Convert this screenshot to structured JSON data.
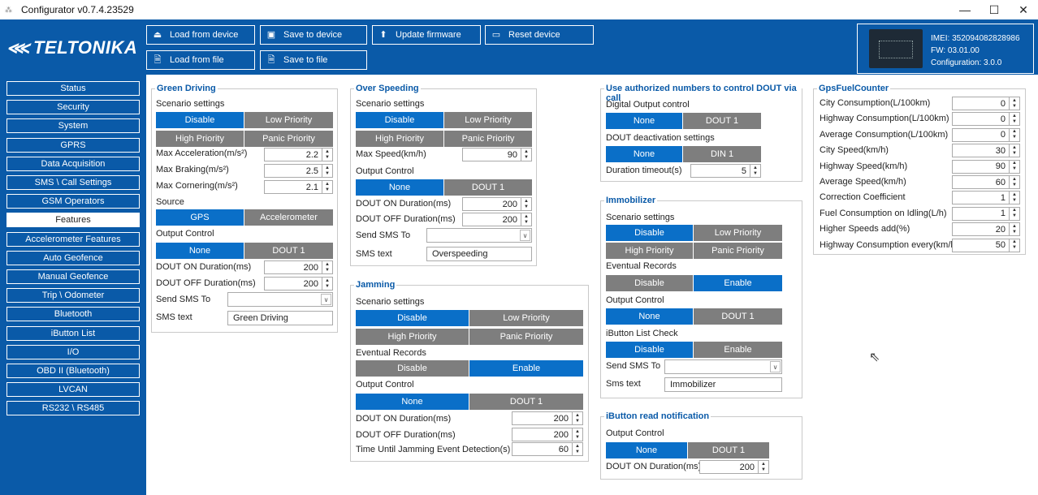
{
  "window": {
    "title": "Configurator v0.7.4.23529",
    "minimize": "—",
    "maximize": "☐",
    "close": "✕"
  },
  "brand": {
    "logo_text": "TELTONIKA"
  },
  "toolbar": {
    "load_device": "Load from device",
    "save_device": "Save to device",
    "update_firmware": "Update firmware",
    "reset_device": "Reset device",
    "load_file": "Load from file",
    "save_file": "Save to file"
  },
  "device": {
    "imei": "IMEI: 352094082828986",
    "fw": "FW: 03.01.00",
    "config": "Configuration: 3.0.0"
  },
  "nav": [
    "Status",
    "Security",
    "System",
    "GPRS",
    "Data Acquisition",
    "SMS \\ Call Settings",
    "GSM Operators",
    "Features",
    "Accelerometer Features",
    "Auto Geofence",
    "Manual Geofence",
    "Trip \\ Odometer",
    "Bluetooth",
    "iButton List",
    "I/O",
    "OBD II (Bluetooth)",
    "LVCAN",
    "RS232 \\ RS485"
  ],
  "nav_active": "Features",
  "green": {
    "title": "Green Driving",
    "scenario_label": "Scenario settings",
    "disable": "Disable",
    "low": "Low Priority",
    "high": "High Priority",
    "panic": "Panic Priority",
    "max_acc_label": "Max Acceleration(m/s²)",
    "max_acc": "2.2",
    "max_brk_label": "Max Braking(m/s²)",
    "max_brk": "2.5",
    "max_cor_label": "Max Cornering(m/s²)",
    "max_cor": "2.1",
    "source_label": "Source",
    "gps": "GPS",
    "accel": "Accelerometer",
    "output_label": "Output Control",
    "none": "None",
    "dout1": "DOUT 1",
    "on_label": "DOUT ON Duration(ms)",
    "on": "200",
    "off_label": "DOUT OFF Duration(ms)",
    "off": "200",
    "sms_to_label": "Send SMS To",
    "sms_text_label": "SMS text",
    "sms_text": "Green Driving"
  },
  "overspeed": {
    "title": "Over Speeding",
    "scenario_label": "Scenario settings",
    "disable": "Disable",
    "low": "Low Priority",
    "high": "High Priority",
    "panic": "Panic Priority",
    "max_speed_label": "Max Speed(km/h)",
    "max_speed": "90",
    "output_label": "Output Control",
    "none": "None",
    "dout1": "DOUT 1",
    "on_label": "DOUT ON Duration(ms)",
    "on": "200",
    "off_label": "DOUT OFF Duration(ms)",
    "off": "200",
    "sms_to_label": "Send SMS To",
    "sms_text_label": "SMS text",
    "sms_text": "Overspeeding"
  },
  "jamming": {
    "title": "Jamming",
    "scenario_label": "Scenario settings",
    "disable": "Disable",
    "low": "Low Priority",
    "high": "High Priority",
    "panic": "Panic Priority",
    "records_label": "Eventual Records",
    "rec_disable": "Disable",
    "rec_enable": "Enable",
    "output_label": "Output Control",
    "none": "None",
    "dout1": "DOUT 1",
    "on_label": "DOUT ON Duration(ms)",
    "on": "200",
    "off_label": "DOUT OFF Duration(ms)",
    "off": "200",
    "detect_label": "Time Until Jamming Event Detection(s)",
    "detect": "60"
  },
  "auth": {
    "title": "Use authorized numbers to control DOUT via call",
    "dout_label": "Digital Output control",
    "none": "None",
    "dout1": "DOUT 1",
    "deact_label": "DOUT deactivation settings",
    "deact_none": "None",
    "din1": "DIN 1",
    "timeout_label": "Duration timeout(s)",
    "timeout": "5"
  },
  "immob": {
    "title": "Immobilizer",
    "scenario_label": "Scenario settings",
    "disable": "Disable",
    "low": "Low Priority",
    "high": "High Priority",
    "panic": "Panic Priority",
    "records_label": "Eventual Records",
    "rec_disable": "Disable",
    "rec_enable": "Enable",
    "output_label": "Output Control",
    "none": "None",
    "dout1": "DOUT 1",
    "ibutton_label": "iButton List Check",
    "ib_disable": "Disable",
    "ib_enable": "Enable",
    "sms_to_label": "Send SMS To",
    "sms_text_label": "Sms text",
    "sms_text": "Immobilizer"
  },
  "ibnotif": {
    "title": "iButton read notification",
    "output_label": "Output Control",
    "none": "None",
    "dout1": "DOUT 1",
    "on_label": "DOUT ON Duration(ms)",
    "on": "200"
  },
  "fuel": {
    "title": "GpsFuelCounter",
    "rows": [
      {
        "label": "City Consumption(L/100km)",
        "value": "0"
      },
      {
        "label": "Highway Consumption(L/100km)",
        "value": "0"
      },
      {
        "label": "Average Consumption(L/100km)",
        "value": "0"
      },
      {
        "label": "City Speed(km/h)",
        "value": "30"
      },
      {
        "label": "Highway Speed(km/h)",
        "value": "90"
      },
      {
        "label": "Average Speed(km/h)",
        "value": "60"
      },
      {
        "label": "Correction Coefficient",
        "value": "1"
      },
      {
        "label": "Fuel Consumption on Idling(L/h)",
        "value": "1"
      },
      {
        "label": "Higher Speeds add(%)",
        "value": "20"
      },
      {
        "label": "Highway Consumption every(km/h)",
        "value": "50"
      }
    ]
  },
  "colors": {
    "brand_blue": "#0a5aa8",
    "selected": "#0a6fc8",
    "unselected": "#7e7e7e"
  }
}
